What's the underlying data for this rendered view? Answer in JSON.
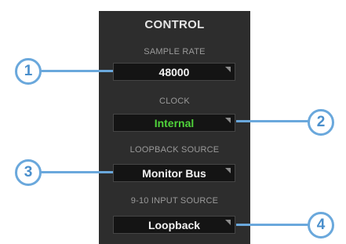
{
  "panel": {
    "title": "CONTROL",
    "sections": [
      {
        "label": "SAMPLE RATE",
        "value": "48000",
        "value_color": "#f2f2f2"
      },
      {
        "label": "CLOCK",
        "value": "Internal",
        "value_color": "#4fd23a"
      },
      {
        "label": "LOOPBACK SOURCE",
        "value": "Monitor Bus",
        "value_color": "#f2f2f2"
      },
      {
        "label": "9-10 INPUT SOURCE",
        "value": "Loopback",
        "value_color": "#f2f2f2"
      }
    ]
  },
  "callouts": [
    "1",
    "2",
    "3",
    "4"
  ],
  "colors": {
    "panel_bg": "#2d2d2d",
    "dropdown_bg": "#141414",
    "accent_green": "#4fd23a",
    "callout_blue": "#6aa8dc"
  },
  "icons": [
    "dropdown-arrow-icon"
  ]
}
